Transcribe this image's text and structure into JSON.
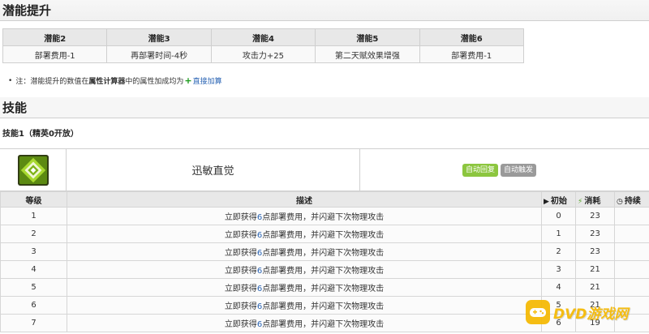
{
  "potential": {
    "heading": "潜能提升",
    "headers": [
      "潜能2",
      "潜能3",
      "潜能4",
      "潜能5",
      "潜能6"
    ],
    "values": [
      "部署费用-1",
      "再部署时间-4秒",
      "攻击力+25",
      "第二天赋效果增强",
      "部署费用-1"
    ]
  },
  "note": {
    "bullet": "•",
    "prefix": "注：潜能提升的数值在",
    "bold_link": "属性计算器",
    "middle": "中的属性加成均为",
    "plus": "+",
    "link": "直接加算"
  },
  "skills": {
    "heading": "技能",
    "caption": "技能1（精英0开放）",
    "skill1": {
      "icon": "skill-diamond-icon",
      "name": "迅敏直觉",
      "tags": [
        "自动回复",
        "自动触发"
      ]
    },
    "columns": {
      "level": "等级",
      "description": "描述",
      "initial": "初始",
      "cost": "消耗",
      "duration": "持续"
    },
    "rows": [
      {
        "level": "1",
        "desc_pre": "立即获得",
        "desc_num": "6",
        "desc_post": "点部署费用，并闪避下次物理攻击",
        "initial": "0",
        "cost": "23"
      },
      {
        "level": "2",
        "desc_pre": "立即获得",
        "desc_num": "6",
        "desc_post": "点部署费用，并闪避下次物理攻击",
        "initial": "1",
        "cost": "23"
      },
      {
        "level": "3",
        "desc_pre": "立即获得",
        "desc_num": "6",
        "desc_post": "点部署费用，并闪避下次物理攻击",
        "initial": "2",
        "cost": "23"
      },
      {
        "level": "4",
        "desc_pre": "立即获得",
        "desc_num": "6",
        "desc_post": "点部署费用，并闪避下次物理攻击",
        "initial": "3",
        "cost": "21"
      },
      {
        "level": "5",
        "desc_pre": "立即获得",
        "desc_num": "6",
        "desc_post": "点部署费用，并闪避下次物理攻击",
        "initial": "4",
        "cost": "21"
      },
      {
        "level": "6",
        "desc_pre": "立即获得",
        "desc_num": "6",
        "desc_post": "点部署费用，并闪避下次物理攻击",
        "initial": "5",
        "cost": "21"
      },
      {
        "level": "7",
        "desc_pre": "立即获得",
        "desc_num": "6",
        "desc_post": "点部署费用，并闪避下次物理攻击",
        "initial": "6",
        "cost": "19"
      }
    ]
  },
  "watermark": {
    "text": "DVD游戏网",
    "icon": "gamepad-icon"
  },
  "colors": {
    "tag_green": "#8cc63f",
    "tag_gray": "#9a9a9a",
    "link_blue": "#2a64b4",
    "plus_green": "#1a9a1a",
    "watermark_yellow": "#f5b800"
  }
}
